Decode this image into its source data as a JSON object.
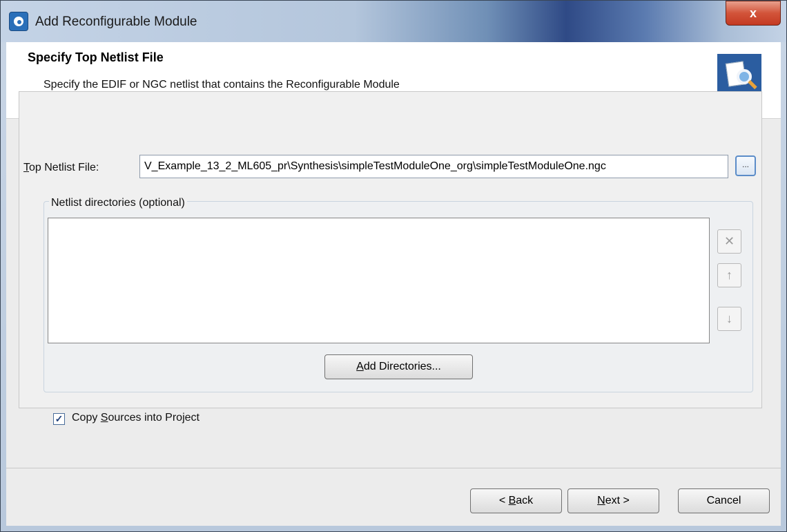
{
  "window": {
    "title": "Add Reconfigurable Module",
    "close_glyph": "x"
  },
  "header": {
    "title": "Specify Top Netlist File",
    "subtitle": "Specify the EDIF or NGC netlist that contains the Reconfigurable Module",
    "icon": "wizard-document-magnifier-icon"
  },
  "form": {
    "netlist_label_prefix": "T",
    "netlist_label_rest": "op Netlist File:",
    "netlist_value": "V_Example_13_2_ML605_pr\\Synthesis\\simpleTestModuleOne_org\\simpleTestModuleOne.ngc",
    "browse_label": "...",
    "directories_legend": "Netlist directories (optional)",
    "directories": [],
    "remove_icon": "close-x-icon",
    "move_up_icon": "arrow-up-icon",
    "move_down_icon": "arrow-down-icon",
    "add_directories_prefix": "A",
    "add_directories_rest": "dd Directories...",
    "copy_sources_checked": true,
    "copy_sources_label_a": "Copy ",
    "copy_sources_label_s": "S",
    "copy_sources_label_b": "ources into Project"
  },
  "footer": {
    "back_pre": "< ",
    "back_u": "B",
    "back_rest": "ack",
    "next_u": "N",
    "next_rest": "ext >",
    "cancel": "Cancel"
  }
}
